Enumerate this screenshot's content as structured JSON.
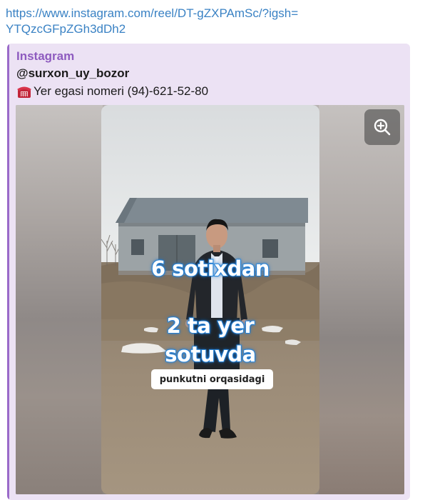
{
  "message": {
    "link_text": "https://www.instagram.com/reel/DT-gZXPAmSc/?igsh=YTQzcGFpZGh3dDh2"
  },
  "preview": {
    "site_name": "Instagram",
    "author": "@surxon_uy_bozor",
    "description": "Yer egasi nomeri (94)-621-52-80",
    "description_icon": "telephone-icon",
    "accent_color": "#9a6ac9",
    "background_color": "#ece2f4"
  },
  "media": {
    "zoom_icon": "zoom-in-icon",
    "caption_line1": "6 sotixdan",
    "caption_line2": "2 ta yer",
    "caption_line3": "sotuvda",
    "sticker_text": "punkutni orqasidagi",
    "caption_color": "#2f8fe0"
  }
}
